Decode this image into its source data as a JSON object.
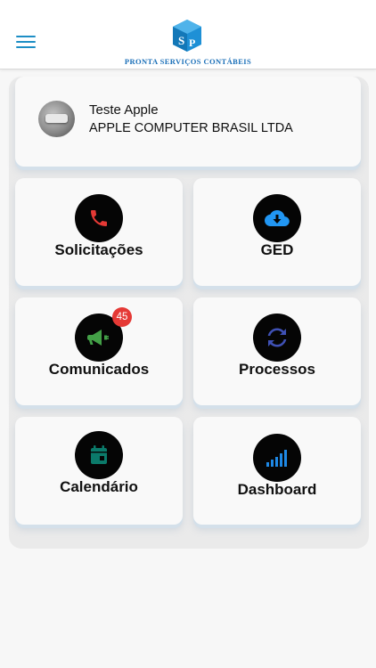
{
  "header": {
    "brand_text": "PRONTA SERVIÇOS CONTÁBEIS"
  },
  "user": {
    "name": "Teste Apple",
    "company": "APPLE COMPUTER BRASIL LTDA"
  },
  "tiles": [
    {
      "label": "Solicitações",
      "icon": "phone-icon",
      "icon_color": "#e53935"
    },
    {
      "label": "GED",
      "icon": "cloud-download-icon",
      "icon_color": "#2196f3"
    },
    {
      "label": "Comunicados",
      "icon": "megaphone-icon",
      "icon_color": "#43a047",
      "badge": "45"
    },
    {
      "label": "Processos",
      "icon": "refresh-icon",
      "icon_color": "#3f51b5"
    },
    {
      "label": "Calendário",
      "icon": "calendar-icon",
      "icon_color": "#0b7a6a"
    },
    {
      "label": "Dashboard",
      "icon": "signal-bars-icon",
      "icon_color": "#1e88e5"
    }
  ],
  "colors": {
    "accent": "#1d8ec5",
    "badge": "#e53935",
    "brand_text": "#1a6fb8"
  }
}
